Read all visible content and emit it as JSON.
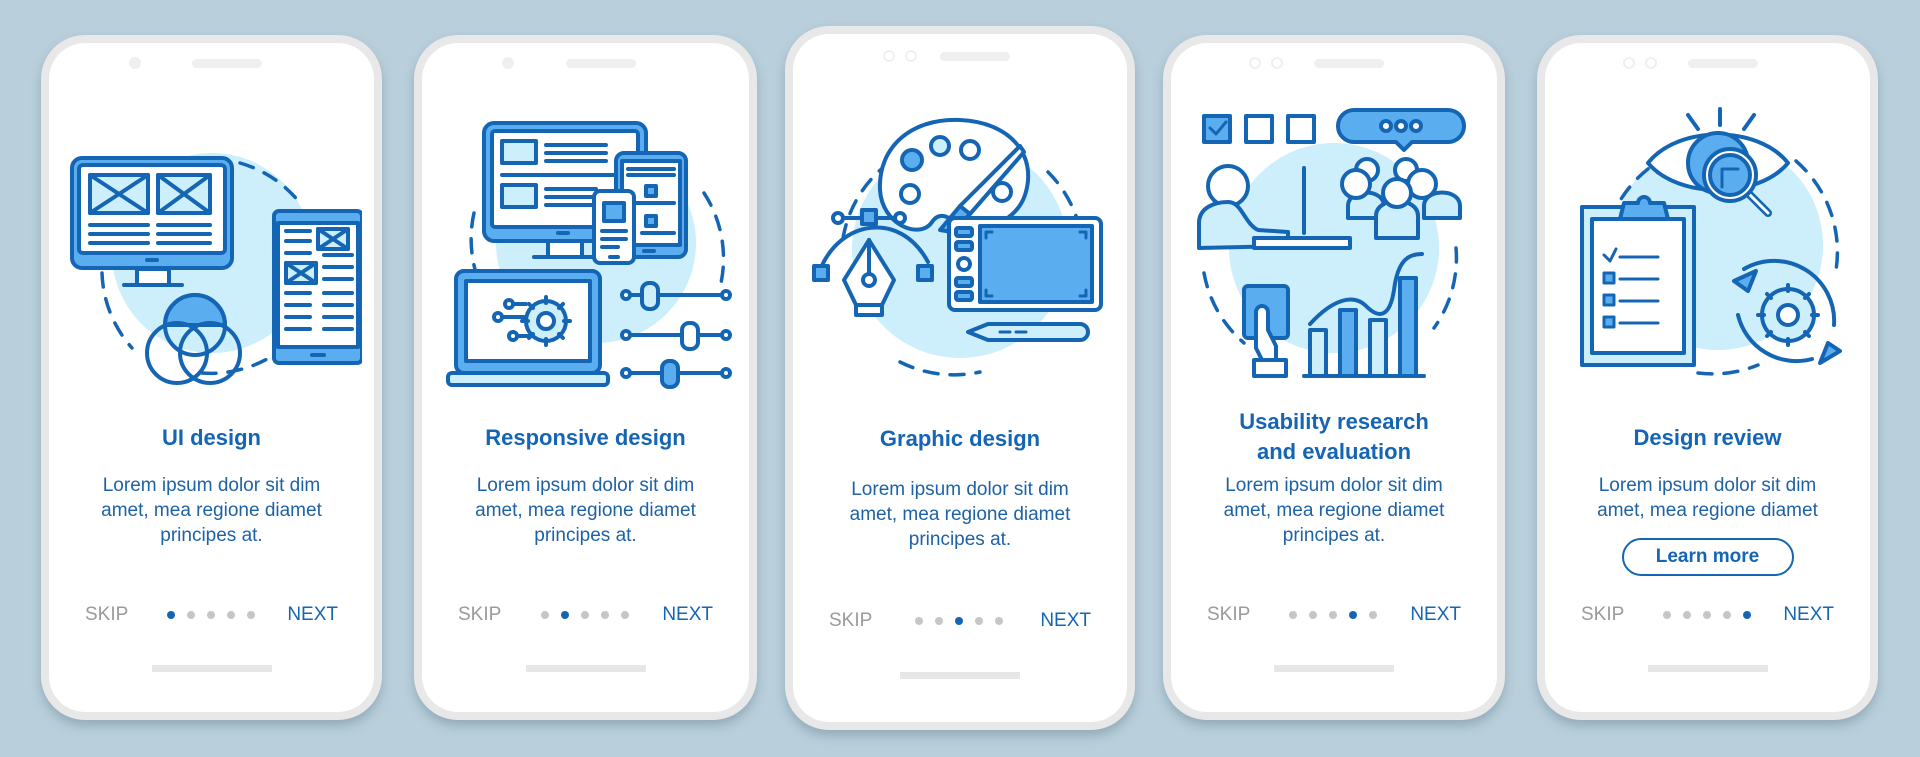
{
  "theme": {
    "background": "#b9cfdb",
    "accent": "#1565b5",
    "illustration_fill": "#5aaef0",
    "illustration_light": "#cdeefb",
    "inactive_dot": "#c6c6c6",
    "skip_color": "#9a9a9a"
  },
  "screens": [
    {
      "illustration": "ui-design-illustration",
      "title_lines": [
        "UI design"
      ],
      "description_lines": [
        "Lorem ipsum dolor sit dim",
        "amet, mea regione diamet",
        "principes at."
      ],
      "skip_label": "SKIP",
      "next_label": "NEXT",
      "page_count": 5,
      "active_page": 1
    },
    {
      "illustration": "responsive-design-illustration",
      "title_lines": [
        "Responsive design"
      ],
      "description_lines": [
        "Lorem ipsum dolor sit dim",
        "amet, mea regione diamet",
        "principes at."
      ],
      "skip_label": "SKIP",
      "next_label": "NEXT",
      "page_count": 5,
      "active_page": 2
    },
    {
      "illustration": "graphic-design-illustration",
      "title_lines": [
        "Graphic design"
      ],
      "description_lines": [
        "Lorem ipsum dolor sit dim",
        "amet, mea regione diamet",
        "principes at."
      ],
      "skip_label": "SKIP",
      "next_label": "NEXT",
      "page_count": 5,
      "active_page": 3
    },
    {
      "illustration": "usability-research-illustration",
      "title_lines": [
        "Usability research",
        "and evaluation"
      ],
      "description_lines": [
        "Lorem ipsum dolor sit dim",
        "amet, mea regione diamet",
        "principes at."
      ],
      "skip_label": "SKIP",
      "next_label": "NEXT",
      "page_count": 5,
      "active_page": 4
    },
    {
      "illustration": "design-review-illustration",
      "title_lines": [
        "Design review"
      ],
      "description_lines": [
        "Lorem ipsum dolor sit dim",
        "amet, mea regione diamet"
      ],
      "button_label": "Learn more",
      "skip_label": "SKIP",
      "next_label": "NEXT",
      "page_count": 5,
      "active_page": 5
    }
  ]
}
